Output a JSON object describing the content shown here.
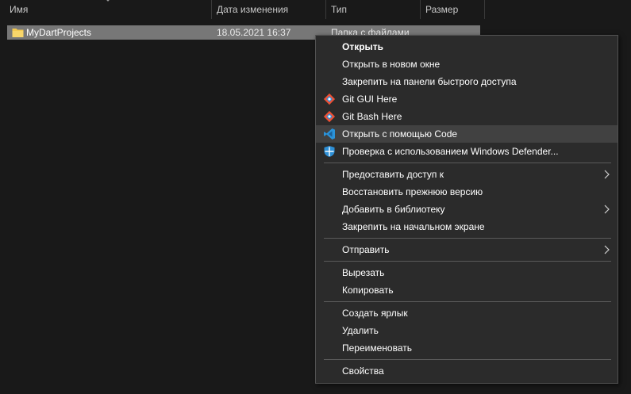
{
  "columns": {
    "name": "Имя",
    "date": "Дата изменения",
    "type": "Тип",
    "size": "Размер"
  },
  "file": {
    "name": "MyDartProjects",
    "date": "18.05.2021 16:37",
    "type": "Папка с файлами"
  },
  "menu": {
    "open": "Открыть",
    "open_new_window": "Открыть в новом окне",
    "pin_quick_access": "Закрепить на панели быстрого доступа",
    "git_gui": "Git GUI Here",
    "git_bash": "Git Bash Here",
    "open_with_code": "Открыть с помощью Code",
    "defender": "Проверка с использованием Windows Defender...",
    "give_access": "Предоставить доступ к",
    "restore_prev": "Восстановить прежнюю версию",
    "add_library": "Добавить в библиотеку",
    "pin_start": "Закрепить на начальном экране",
    "send_to": "Отправить",
    "cut": "Вырезать",
    "copy": "Копировать",
    "create_shortcut": "Создать ярлык",
    "delete": "Удалить",
    "rename": "Переименовать",
    "properties": "Свойства"
  },
  "colors": {
    "background": "#191919",
    "menu_bg": "#2b2b2b",
    "highlight": "#414141",
    "selection": "#777777",
    "folder": "#f3c94f",
    "vscode": "#2a93d9",
    "git": "#f05033"
  },
  "icons": {
    "folder": "folder-icon",
    "git_gui": "git-icon",
    "git_bash": "git-icon",
    "code": "vscode-icon",
    "defender": "defender-shield-icon",
    "submenu": "chevron-right-icon",
    "sort": "sort-arrow-icon"
  }
}
